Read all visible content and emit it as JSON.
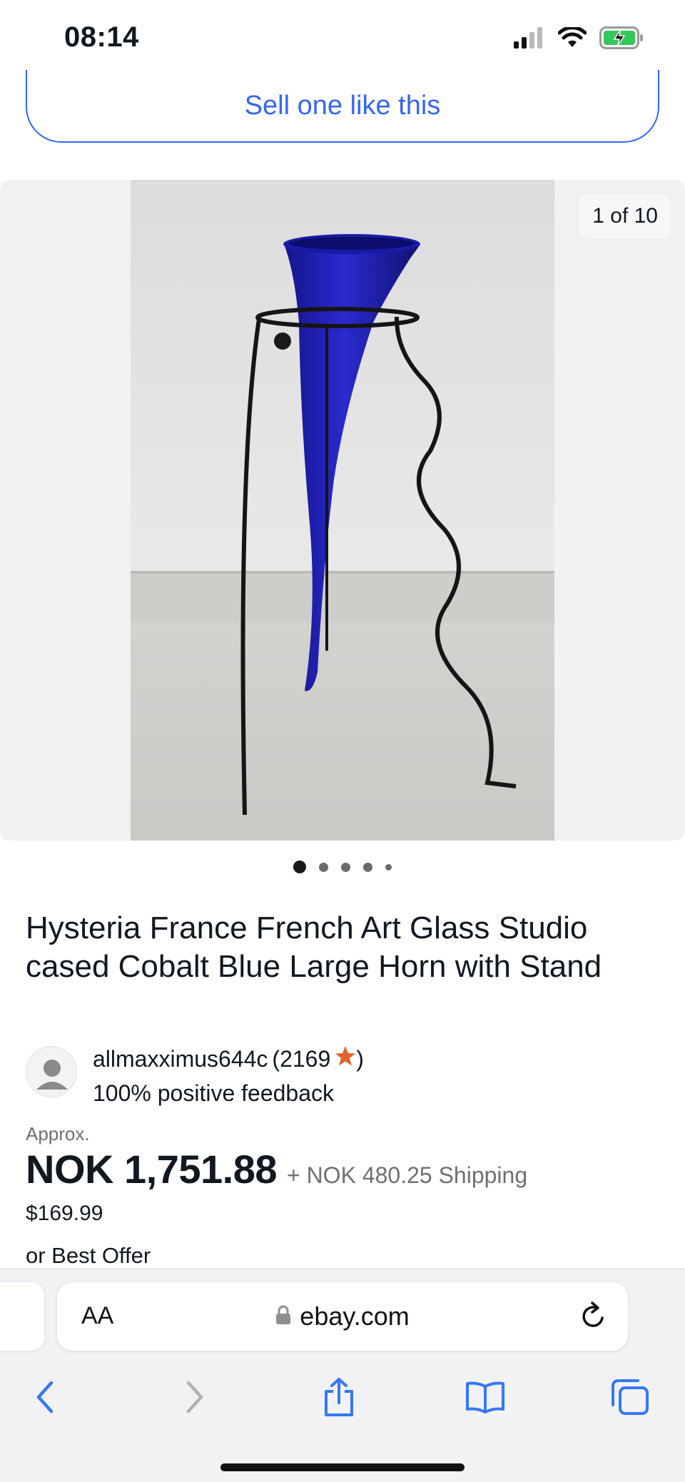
{
  "status_bar": {
    "time": "08:14",
    "icons": [
      "cellular-signal-icon",
      "wifi-icon",
      "battery-charging-icon"
    ]
  },
  "sell_button": {
    "label": "Sell one like this"
  },
  "gallery": {
    "counter": "1 of 10",
    "current_index": 1,
    "total": 10,
    "dots": 5
  },
  "listing": {
    "title": "Hysteria France French Art Glass Studio cased Cobalt Blue Large Horn with Stand",
    "seller": {
      "name": "allmaxximus644c",
      "score_open": "(2169",
      "score_close": ")",
      "feedback": "100% positive feedback"
    },
    "price": {
      "approx_label": "Approx.",
      "amount": "NOK 1,751.88",
      "shipping": "+ NOK 480.25 Shipping",
      "usd": "$169.99",
      "best_offer": "or Best Offer"
    }
  },
  "browser": {
    "text_size_label": "AA",
    "domain": "ebay.com",
    "toolbar": [
      "back-icon",
      "forward-icon",
      "share-icon",
      "bookmarks-icon",
      "tabs-icon"
    ]
  },
  "colors": {
    "accent": "#3665f3",
    "star": "#e0652a",
    "text": "#111820",
    "muted": "#707070"
  }
}
